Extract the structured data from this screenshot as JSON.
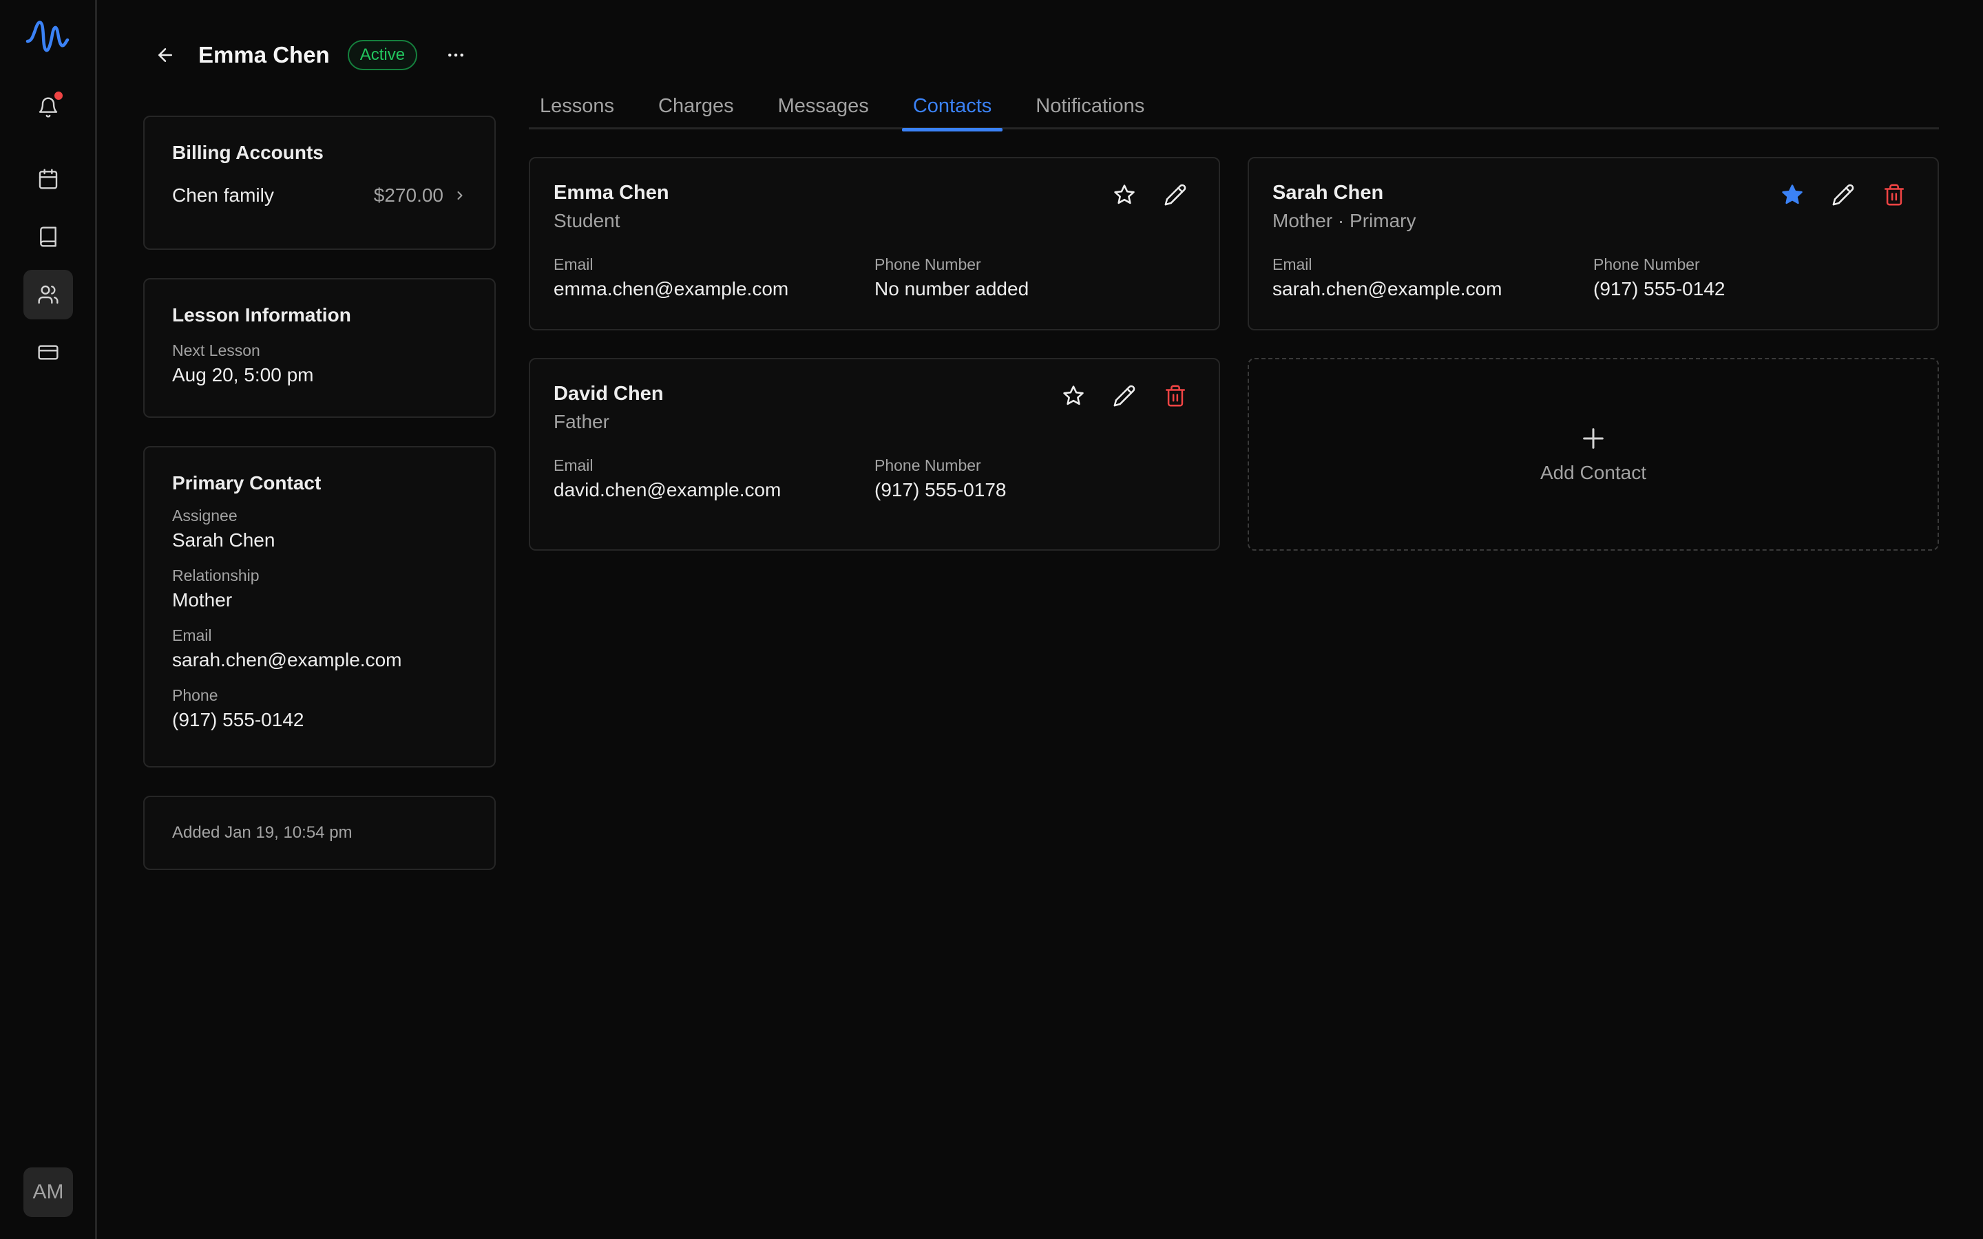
{
  "rail": {
    "logo": "waveform-logo",
    "items": [
      {
        "icon": "bell-icon",
        "has_badge": true
      },
      {
        "icon": "calendar-icon"
      },
      {
        "icon": "book-icon"
      },
      {
        "icon": "users-icon",
        "active": true
      },
      {
        "icon": "credit-card-icon"
      }
    ],
    "user_initials": "AM"
  },
  "header": {
    "title": "Emma Chen",
    "status": "Active",
    "status_color": "#22c55e"
  },
  "billing": {
    "title": "Billing Accounts",
    "account_name": "Chen family",
    "amount": "$270.00"
  },
  "lesson": {
    "title": "Lesson Information",
    "next_label": "Next Lesson",
    "next_value": "Aug 20, 5:00 pm"
  },
  "primary_contact": {
    "title": "Primary Contact",
    "assignee_label": "Assignee",
    "assignee": "Sarah Chen",
    "relationship_label": "Relationship",
    "relationship": "Mother",
    "email_label": "Email",
    "email": "sarah.chen@example.com",
    "phone_label": "Phone",
    "phone": "(917) 555-0142"
  },
  "added": "Added Jan 19, 10:54 pm",
  "tabs": [
    {
      "label": "Lessons"
    },
    {
      "label": "Charges"
    },
    {
      "label": "Messages"
    },
    {
      "label": "Contacts",
      "active": true
    },
    {
      "label": "Notifications"
    }
  ],
  "accent_color": "#3b82f6",
  "danger_color": "#ef4444",
  "contacts": [
    {
      "name": "Emma Chen",
      "role": "Student",
      "email_label": "Email",
      "email": "emma.chen@example.com",
      "phone_label": "Phone Number",
      "phone": "No number added",
      "starred": false,
      "deletable": false
    },
    {
      "name": "Sarah Chen",
      "role": "Mother · Primary",
      "email_label": "Email",
      "email": "sarah.chen@example.com",
      "phone_label": "Phone Number",
      "phone": "(917) 555-0142",
      "starred": true,
      "deletable": true
    },
    {
      "name": "David Chen",
      "role": "Father",
      "email_label": "Email",
      "email": "david.chen@example.com",
      "phone_label": "Phone Number",
      "phone": "(917) 555-0178",
      "starred": false,
      "deletable": true
    }
  ],
  "add_contact_label": "Add Contact"
}
